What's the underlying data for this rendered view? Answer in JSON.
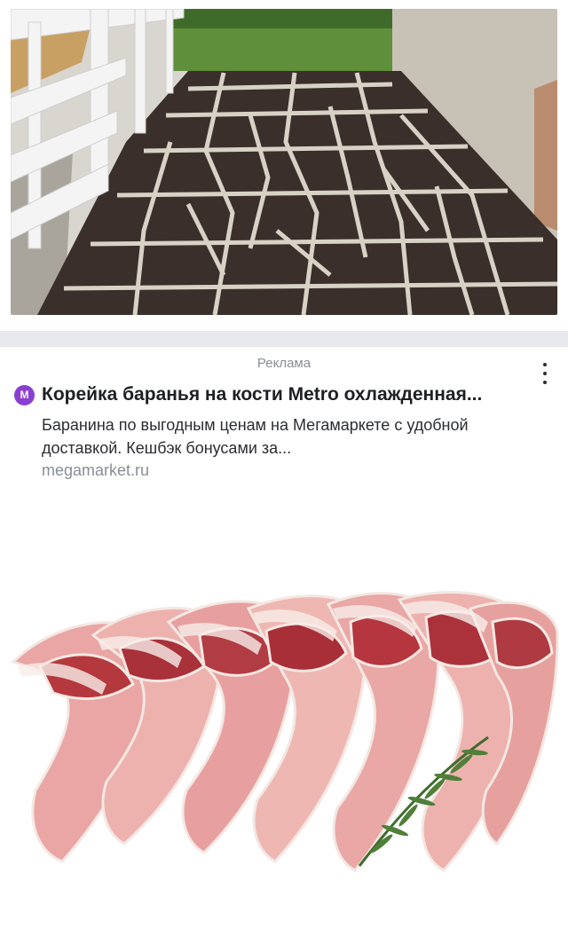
{
  "ad": {
    "label": "Реклама",
    "brand_initial": "M",
    "title": "Корейка баранья на кости Metro охлажденная...",
    "description": "Баранина по выгодным ценам на Мегамаркете с удобной доставкой. Кешбэк бонусами за...",
    "domain": "megamarket.ru"
  },
  "icons": {
    "more": "more-vertical-icon",
    "brand": "megamarket-logo"
  },
  "colors": {
    "brand": "#8b3fd1",
    "divider": "#e8e9ec",
    "muted_text": "#8a8e94"
  }
}
